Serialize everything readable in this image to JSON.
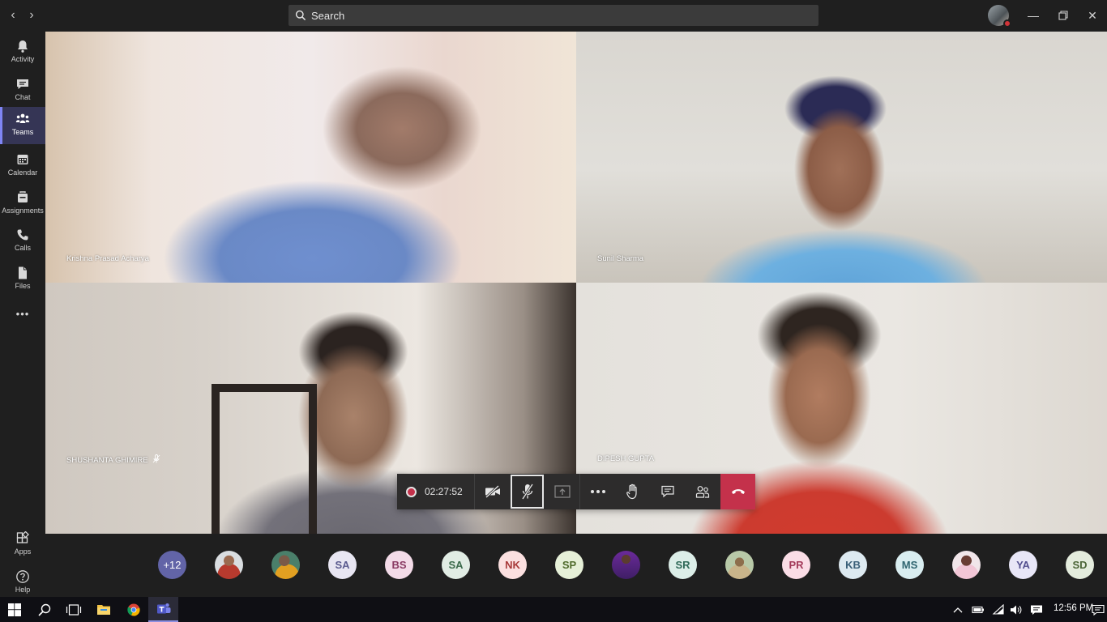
{
  "title_bar": {
    "back_icon": "chevron-left",
    "forward_icon": "chevron-right",
    "search_placeholder": "Search",
    "window_controls": [
      "minimize",
      "restore",
      "close"
    ]
  },
  "rail": {
    "items": [
      {
        "label": "Activity",
        "icon": "bell-icon"
      },
      {
        "label": "Chat",
        "icon": "chat-icon"
      },
      {
        "label": "Teams",
        "icon": "teams-icon",
        "active": true
      },
      {
        "label": "Calendar",
        "icon": "calendar-icon"
      },
      {
        "label": "Assignments",
        "icon": "assignments-icon"
      },
      {
        "label": "Calls",
        "icon": "phone-icon"
      },
      {
        "label": "Files",
        "icon": "file-icon"
      }
    ],
    "more": "•••",
    "bottom": [
      {
        "label": "Apps",
        "icon": "apps-icon"
      },
      {
        "label": "Help",
        "icon": "help-icon"
      }
    ]
  },
  "tiles": [
    {
      "name": "Krishna Prasad Acharya"
    },
    {
      "name": "Sunil Sharma"
    },
    {
      "name": "SHUSHANTA GHIMIRE",
      "muted": true
    },
    {
      "name": "DIPESH GUPTA"
    }
  ],
  "controls": {
    "timer": "02:27:52",
    "buttons": [
      "camera-off",
      "mic-off",
      "share-screen",
      "more",
      "raise-hand",
      "chat",
      "participants",
      "hang-up"
    ]
  },
  "participants": {
    "overflow": "+12",
    "avatars": [
      {
        "initials": "",
        "photo": true
      },
      {
        "initials": "",
        "photo": true
      },
      {
        "initials": "SA",
        "bg": "#e8e6f2",
        "fg": "#5b5b8f"
      },
      {
        "initials": "BS",
        "bg": "#f3dbe8",
        "fg": "#8a3a63"
      },
      {
        "initials": "SA",
        "bg": "#e1ece4",
        "fg": "#3c6b4c"
      },
      {
        "initials": "NK",
        "bg": "#fbe0e0",
        "fg": "#a83a3a"
      },
      {
        "initials": "SP",
        "bg": "#e6f0d8",
        "fg": "#4f6b2c"
      },
      {
        "initials": "",
        "photo": true
      },
      {
        "initials": "SR",
        "bg": "#dceee8",
        "fg": "#2f6a58"
      },
      {
        "initials": "",
        "photo": true
      },
      {
        "initials": "PR",
        "bg": "#fadde6",
        "fg": "#a33a5a"
      },
      {
        "initials": "KB",
        "bg": "#dde9f0",
        "fg": "#3a5f78"
      },
      {
        "initials": "MS",
        "bg": "#d9edf0",
        "fg": "#2f6570"
      },
      {
        "initials": "",
        "photo": true
      },
      {
        "initials": "YA",
        "bg": "#e8e6f7",
        "fg": "#54508f"
      },
      {
        "initials": "SD",
        "bg": "#e4ecdd",
        "fg": "#4c6638"
      }
    ]
  },
  "taskbar": {
    "clock": "12:56 PM"
  }
}
